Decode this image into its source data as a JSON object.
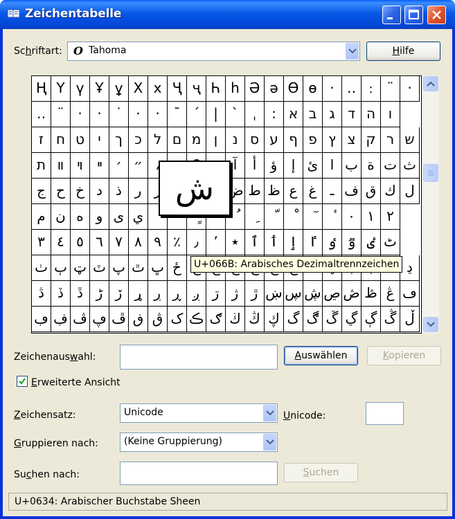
{
  "window": {
    "title": "Zeichentabelle"
  },
  "font_row": {
    "label_pre": "Sc",
    "label_u": "h",
    "label_post": "riftart:",
    "font_icon": "opentype-font-icon",
    "value": "Tahoma",
    "help_pre": "",
    "help_u": "H",
    "help_post": "ilfe"
  },
  "grid": {
    "rows": [
      [
        "Ң",
        "Ү",
        "ү",
        "Ұ",
        "ұ",
        "Х",
        "х",
        "Ҷ",
        "ҷ",
        "Һ",
        "һ",
        "Ә",
        "ә",
        "Ө",
        "ө",
        "·",
        "‥",
        "﹕",
        "¨",
        "‧"
      ],
      [
        "‥",
        "¨",
        "·",
        "‧",
        "˙",
        "⸱",
        "·",
        "ˉ",
        "ˊ",
        "|",
        "ˋ",
        "ˌ",
        ":",
        "א",
        "ב",
        "ג",
        "ד",
        "ה",
        "ו"
      ],
      [
        "ז",
        "ח",
        "ט",
        "י",
        "ך",
        "כ",
        "ל",
        "ם",
        "מ",
        "ן",
        "נ",
        "ס",
        "ע",
        "ף",
        "פ",
        "ץ",
        "צ",
        "ק",
        "ר",
        "ש"
      ],
      [
        "ת",
        "װ",
        "ױ",
        "ײ",
        "׳",
        "״",
        "،",
        "؛",
        "؟",
        "ء",
        "آ",
        "أ",
        "ؤ",
        "إ",
        "ئ",
        "ا",
        "ب",
        "ة",
        "ت",
        "ث"
      ],
      [
        "ج",
        "ح",
        "خ",
        "د",
        "ذ",
        "ر",
        "ز",
        "س",
        "ش",
        "ص",
        "ض",
        "ط",
        "ظ",
        "ع",
        "غ",
        "ـ",
        "ف",
        "ق",
        "ك",
        "ل"
      ],
      [
        "م",
        "ن",
        "ه",
        "و",
        "ى",
        "ي",
        "ً",
        "ٌ",
        "ٍ",
        "َ",
        "ُ",
        "ِ",
        "ّ",
        "ْ",
        "ٓ",
        "ٔ",
        "٠",
        "١",
        "٢"
      ],
      [
        "٣",
        "٤",
        "٥",
        "٦",
        "٧",
        "٨",
        "٩",
        "٪",
        "٫",
        "٬",
        "٭",
        "ٱ",
        "ٲ",
        "ٳ",
        "ٵ",
        "ٶ",
        "ٷ",
        "ٸ",
        "ٹ"
      ],
      [
        "ٺ",
        "ٻ",
        "ټ",
        "ٽ",
        "پ",
        "ٿ",
        "ڀ",
        "ځ",
        "ڂ",
        "ڃ",
        "ڄ",
        "څ",
        "چ",
        "ڇ",
        "ڈ",
        "ډ",
        "ڊ",
        "ڋ",
        "ڌ",
        "ڍ"
      ],
      [
        "ڎ",
        "ڏ",
        "ڐ",
        "ڑ",
        "ڒ",
        "ړ",
        "ڔ",
        "ڕ",
        "ږ",
        "ڗ",
        "ژ",
        "ڙ",
        "ښ",
        "ڛ",
        "ڜ",
        "ڝ",
        "ڞ",
        "ڟ",
        "ڠ",
        "ڡ"
      ],
      [
        "ڢ",
        "ڣ",
        "ڤ",
        "ڥ",
        "ڦ",
        "ڧ",
        "ڨ",
        "ک",
        "ڪ",
        "ګ",
        "ڬ",
        "ڭ",
        "ڮ",
        "گ",
        "ڰ",
        "ڱ",
        "ڲ",
        "ڳ",
        "ڴ",
        "ڵ"
      ]
    ],
    "magnified_char": "ش",
    "tooltip": "U+066B: Arabisches Dezimaltrennzeichen"
  },
  "selection": {
    "label_pre": "Zeichenaus",
    "label_u": "w",
    "label_post": "ahl:",
    "value": "",
    "select_pre": "",
    "select_u": "A",
    "select_post": "uswählen",
    "copy_pre": "",
    "copy_u": "K",
    "copy_post": "opieren"
  },
  "advanced": {
    "checked": true,
    "label_pre": "",
    "label_u": "E",
    "label_post": "rweiterte Ansicht"
  },
  "charset": {
    "label_pre": "",
    "label_u": "Z",
    "label_post": "eichensatz:",
    "value": "Unicode",
    "unicode_pre": "",
    "unicode_u": "U",
    "unicode_post": "nicode:",
    "unicode_value": ""
  },
  "group": {
    "label_pre": "",
    "label_u": "G",
    "label_post": "ruppieren nach:",
    "value": "(Keine Gruppierung)"
  },
  "search": {
    "label_pre": "Su",
    "label_u": "c",
    "label_post": "hen nach:",
    "value": "",
    "button_pre": "",
    "button_u": "S",
    "button_post": "uchen"
  },
  "status": {
    "text": "U+0634: Arabischer Buchstabe Sheen"
  }
}
